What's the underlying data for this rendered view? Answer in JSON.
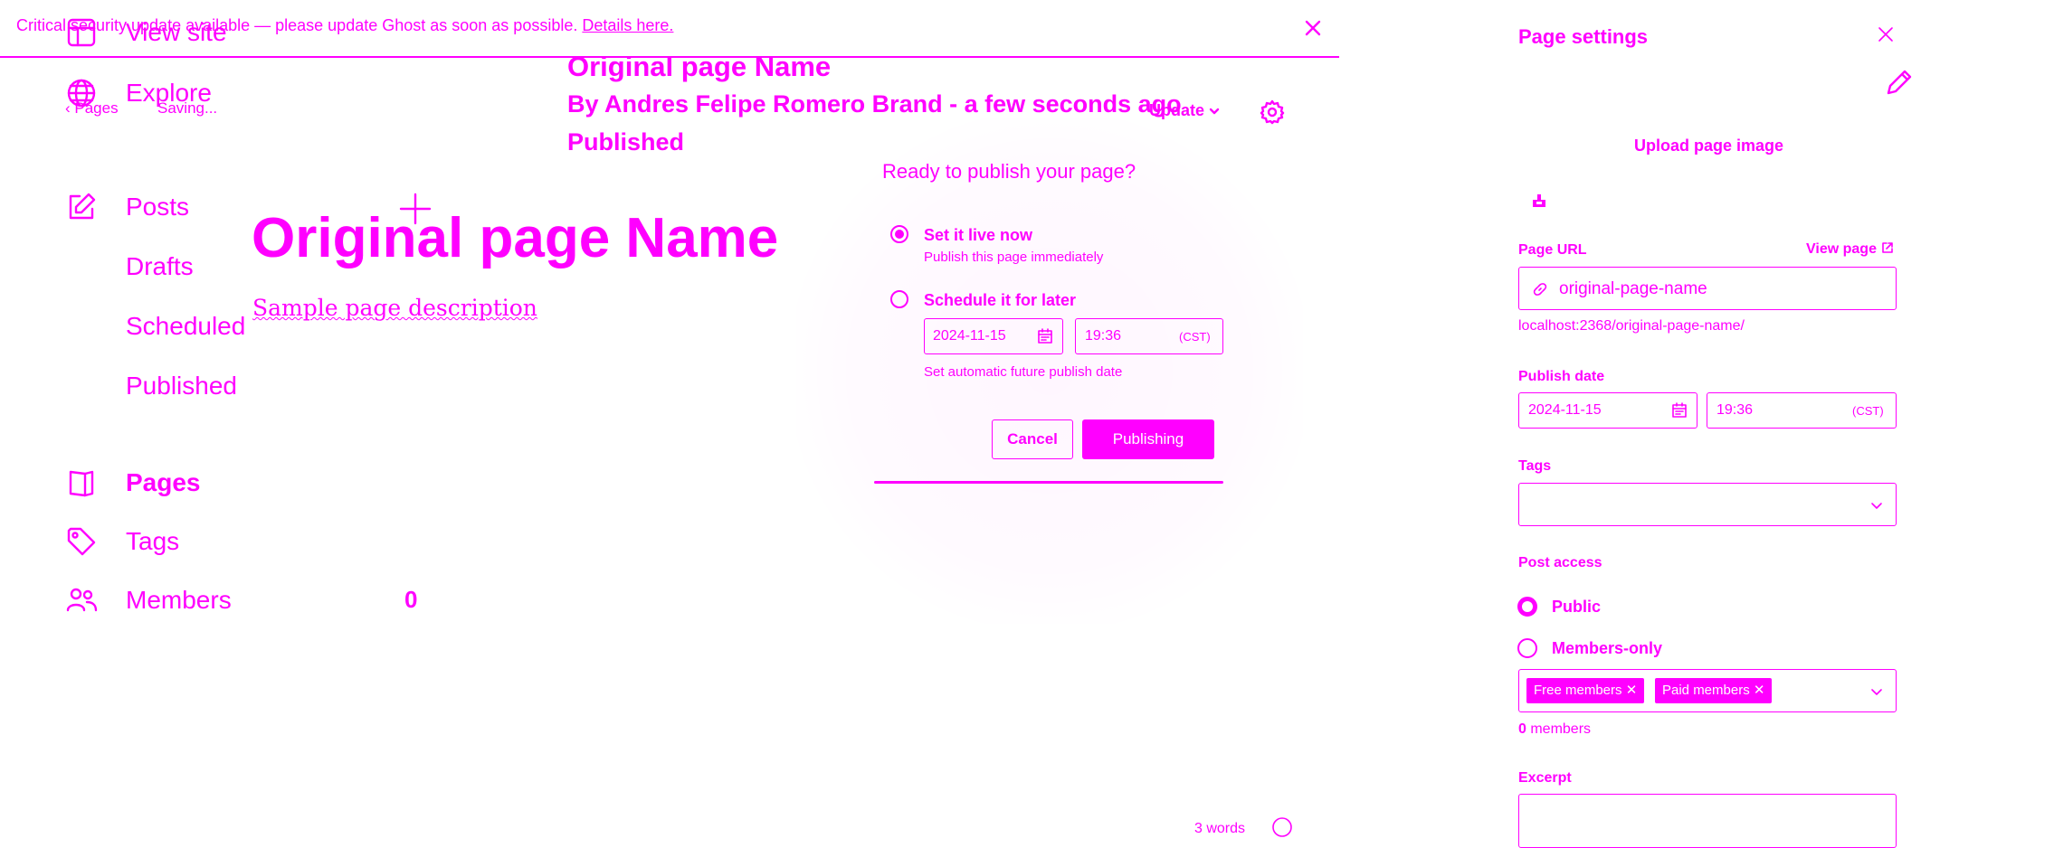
{
  "banner": {
    "text": "Critical security update available — please update Ghost as soon as possible.",
    "link": "Details here."
  },
  "sidebar": {
    "items": [
      {
        "label": "View site",
        "icon": "layout-icon"
      },
      {
        "label": "Explore",
        "icon": "globe-icon"
      },
      {
        "label": "Posts",
        "icon": "edit-icon"
      },
      {
        "label": "Drafts"
      },
      {
        "label": "Scheduled"
      },
      {
        "label": "Published"
      },
      {
        "label": "Pages",
        "icon": "page-icon"
      },
      {
        "label": "Tags",
        "icon": "tag-icon"
      },
      {
        "label": "Members",
        "icon": "members-icon",
        "count": "0"
      }
    ]
  },
  "editor": {
    "back_label": "Pages",
    "saving_label": "Saving...",
    "header_title": "Original page Name",
    "byline": "By Andres Felipe Romero Brand - a few seconds ago",
    "status": "Published",
    "update_label": "Update",
    "page_title": "Original page Name",
    "description": "Sample page description",
    "word_count": "3 words"
  },
  "publish_modal": {
    "title": "Ready to publish your page?",
    "option_now_label": "Set it live now",
    "option_now_desc": "Publish this page immediately",
    "option_later_label": "Schedule it for later",
    "date": "2024-11-15",
    "time": "19:36",
    "timezone": "(CST)",
    "hint": "Set automatic future publish date",
    "cancel_label": "Cancel",
    "publish_label": "Publishing",
    "selected": "now"
  },
  "settings": {
    "title": "Page settings",
    "upload_label": "Upload page image",
    "url_label": "Page URL",
    "view_page_label": "View page",
    "url_value": "original-page-name",
    "url_hint": "localhost:2368/original-page-name/",
    "publish_date_label": "Publish date",
    "date": "2024-11-15",
    "time": "19:36",
    "timezone": "(CST)",
    "tags_label": "Tags",
    "access_label": "Post access",
    "access_options": [
      "Public",
      "Members-only"
    ],
    "access_selected": "Public",
    "chips": [
      "Free members",
      "Paid members"
    ],
    "members_count": "0",
    "members_suffix": " members",
    "excerpt_label": "Excerpt"
  },
  "colors": {
    "accent": "#ff00ff",
    "background": "#ffffff"
  }
}
